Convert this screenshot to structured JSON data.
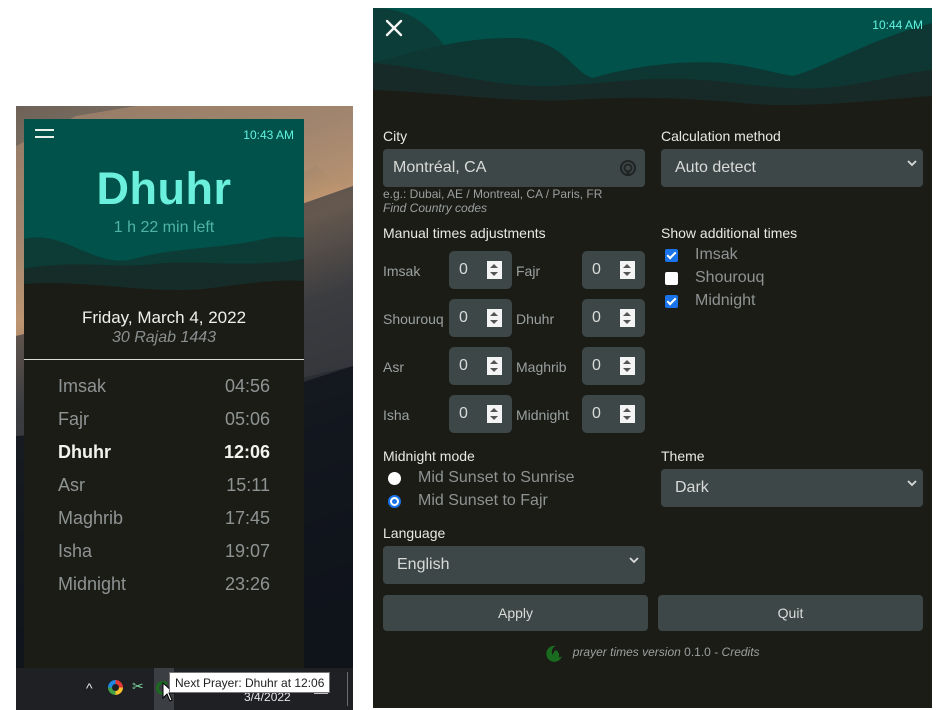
{
  "widget": {
    "clock": "10:43 AM",
    "next_prayer": "Dhuhr",
    "time_left": "1 h 22 min left",
    "gregorian_date": "Friday, March 4, 2022",
    "hijri_date": "30 Rajab 1443",
    "prayers": [
      {
        "name": "Imsak",
        "time": "04:56",
        "active": false
      },
      {
        "name": "Fajr",
        "time": "05:06",
        "active": false
      },
      {
        "name": "Dhuhr",
        "time": "12:06",
        "active": true
      },
      {
        "name": "Asr",
        "time": "15:11",
        "active": false
      },
      {
        "name": "Maghrib",
        "time": "17:45",
        "active": false
      },
      {
        "name": "Isha",
        "time": "19:07",
        "active": false
      },
      {
        "name": "Midnight",
        "time": "23:26",
        "active": false
      }
    ],
    "icons": {
      "menu": "hamburger-menu-icon"
    }
  },
  "taskbar": {
    "date": "3/4/2022",
    "tooltip": "Next Prayer: Dhuhr at 12:06",
    "chevron": "^"
  },
  "settings": {
    "clock": "10:44 AM",
    "city": {
      "label": "City",
      "value": "Montréal, CA",
      "hint": "e.g.: Dubai, AE / Montreal, CA / Paris, FR",
      "link": "Find Country codes"
    },
    "calculation_method": {
      "label": "Calculation method",
      "value": "Auto detect"
    },
    "manual_adjustments": {
      "label": "Manual times adjustments",
      "items": [
        {
          "name": "Imsak",
          "value": "0"
        },
        {
          "name": "Fajr",
          "value": "0"
        },
        {
          "name": "Shourouq",
          "value": "0"
        },
        {
          "name": "Dhuhr",
          "value": "0"
        },
        {
          "name": "Asr",
          "value": "0"
        },
        {
          "name": "Maghrib",
          "value": "0"
        },
        {
          "name": "Isha",
          "value": "0"
        },
        {
          "name": "Midnight",
          "value": "0"
        }
      ]
    },
    "additional_times": {
      "label": "Show additional times",
      "items": [
        {
          "name": "Imsak",
          "checked": true
        },
        {
          "name": "Shourouq",
          "checked": false
        },
        {
          "name": "Midnight",
          "checked": true
        }
      ]
    },
    "midnight_mode": {
      "label": "Midnight mode",
      "options": [
        {
          "name": "Mid Sunset to Sunrise",
          "selected": false
        },
        {
          "name": "Mid Sunset to Fajr",
          "selected": true
        }
      ]
    },
    "theme": {
      "label": "Theme",
      "value": "Dark"
    },
    "language": {
      "label": "Language",
      "value": "English"
    },
    "apply_label": "Apply",
    "quit_label": "Quit",
    "footer": {
      "app_name": "prayer times version",
      "version": "0.1.0",
      "separator": "-",
      "credits": "Credits"
    },
    "accent": "#1a73e8"
  },
  "colors": {
    "teal_header": "#00524a",
    "accent_text": "#6af0dc",
    "panel_bg": "#1c1c17",
    "field_bg": "#3e4747"
  }
}
